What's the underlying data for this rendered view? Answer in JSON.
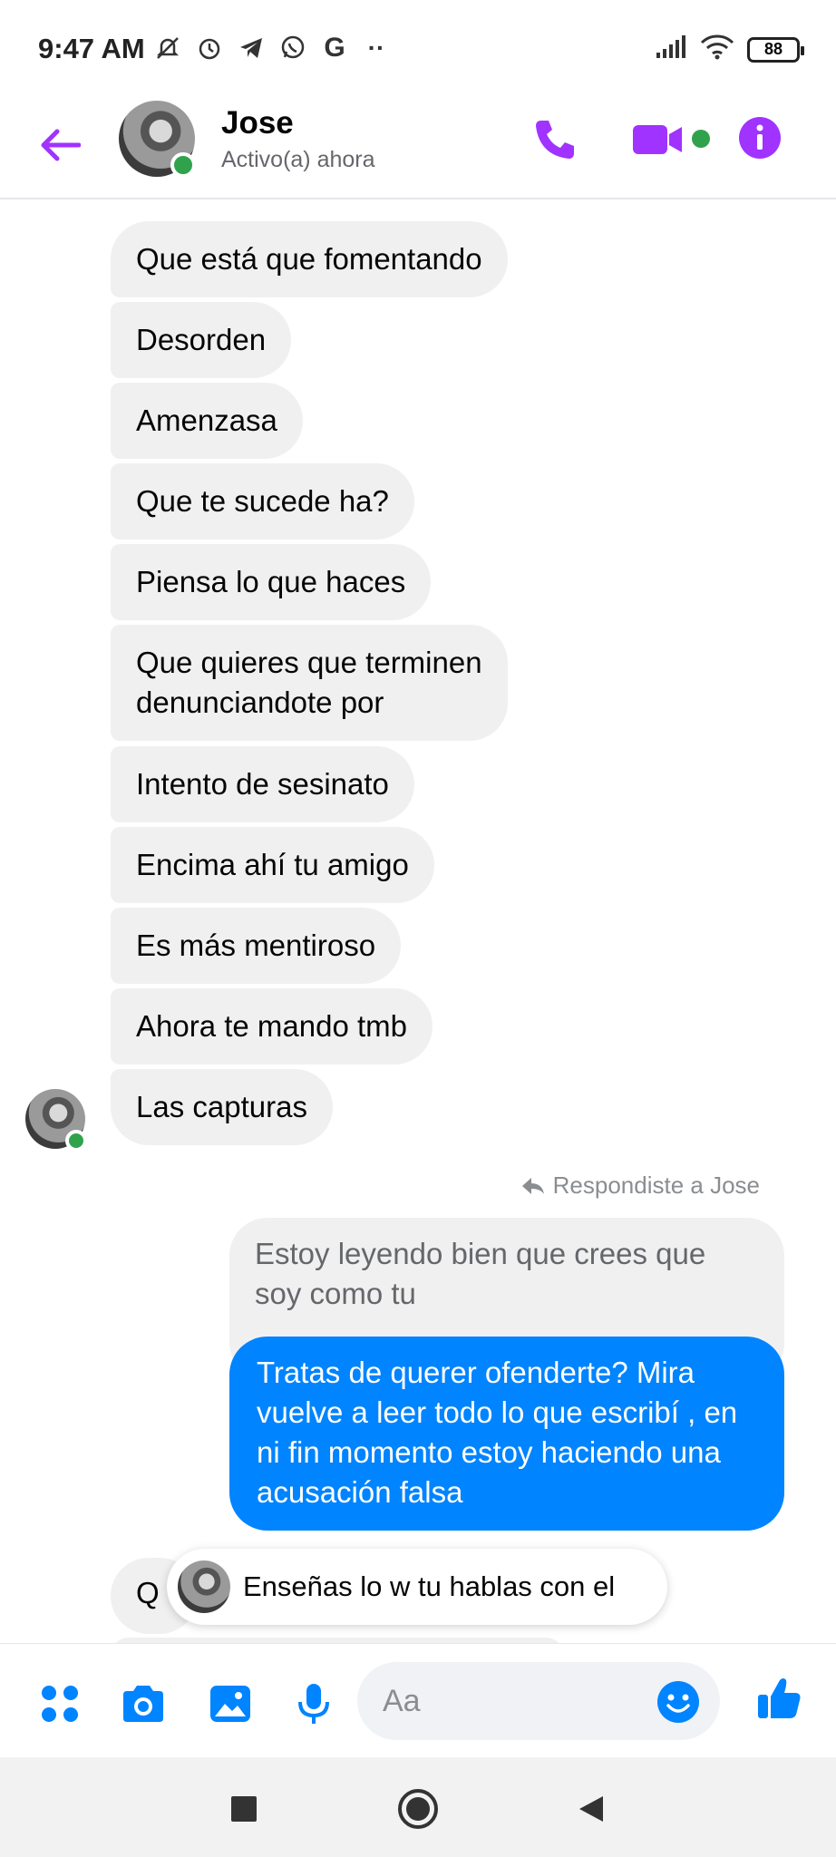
{
  "status_bar": {
    "time": "9:47 AM",
    "battery": "88",
    "icons": [
      "mute-bell-icon",
      "alarm-icon",
      "telegram-icon",
      "whatsapp-icon",
      "google-icon",
      "more-dots-icon",
      "signal-icon",
      "wifi-icon"
    ]
  },
  "header": {
    "contact_name": "Jose",
    "contact_status": "Activo(a) ahora",
    "accent_color": "#a033ff",
    "online_color": "#31a24c"
  },
  "messages": {
    "received": [
      "Que está que fomentando",
      "Desorden",
      "Amenzasa",
      "Que te sucede ha?",
      "Piensa lo que haces",
      "Que quieres que terminen\ndenunciandote por",
      "Intento de sesinato",
      "Encima ahí tu amigo",
      "Es más mentiroso",
      "Ahora te mando tmb",
      "Las capturas"
    ],
    "reply_note": "Respondiste a Jose",
    "quoted_text": "Estoy leyendo bien que crees que soy como tu",
    "sent_text": "Tratas de querer ofenderte? Mira vuelve a leer todo lo que escribí , en ni fin momento estoy haciendo una acusación falsa",
    "partial_text": "Q",
    "new_message_preview": "Enseñas lo w tu hablas con el"
  },
  "composer": {
    "placeholder": "Aa",
    "brand_color": "#0084ff"
  }
}
